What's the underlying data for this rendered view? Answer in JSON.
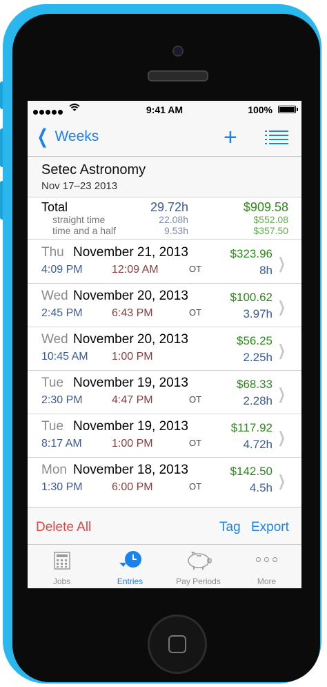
{
  "status_bar": {
    "time": "9:41 AM",
    "battery": "100%",
    "signal_dots": 5
  },
  "nav": {
    "back_label": "Weeks"
  },
  "summary": {
    "job_name": "Setec Astronomy",
    "date_range": "Nov 17–23 2013"
  },
  "totals": {
    "label": "Total",
    "hours": "29.72h",
    "amount": "$909.58",
    "breakdown": [
      {
        "label": "straight time",
        "hours": "22.08h",
        "amount": "$552.08"
      },
      {
        "label": "time and a half",
        "hours": "9.53h",
        "amount": "$357.50"
      }
    ]
  },
  "entries": [
    {
      "dow": "Thu",
      "date": "November 21, 2013",
      "amount": "$323.96",
      "start": "4:09 PM",
      "end": "12:09 AM",
      "ot": "OT",
      "hours": "8h"
    },
    {
      "dow": "Wed",
      "date": "November 20, 2013",
      "amount": "$100.62",
      "start": "2:45 PM",
      "end": "6:43 PM",
      "ot": "OT",
      "hours": "3.97h"
    },
    {
      "dow": "Wed",
      "date": "November 20, 2013",
      "amount": "$56.25",
      "start": "10:45 AM",
      "end": "1:00 PM",
      "ot": "",
      "hours": "2.25h"
    },
    {
      "dow": "Tue",
      "date": "November 19, 2013",
      "amount": "$68.33",
      "start": "2:30 PM",
      "end": "4:47 PM",
      "ot": "OT",
      "hours": "2.28h"
    },
    {
      "dow": "Tue",
      "date": "November 19, 2013",
      "amount": "$117.92",
      "start": "8:17 AM",
      "end": "1:00 PM",
      "ot": "OT",
      "hours": "4.72h"
    },
    {
      "dow": "Mon",
      "date": "November 18, 2013",
      "amount": "$142.50",
      "start": "1:30 PM",
      "end": "6:00 PM",
      "ot": "OT",
      "hours": "4.5h"
    }
  ],
  "toolbar": {
    "delete_all": "Delete All",
    "tag": "Tag",
    "export": "Export"
  },
  "tabs": [
    {
      "label": "Jobs",
      "icon": "calculator-icon",
      "active": false
    },
    {
      "label": "Entries",
      "icon": "clock-icon",
      "active": true
    },
    {
      "label": "Pay Periods",
      "icon": "piggy-bank-icon",
      "active": false
    },
    {
      "label": "More",
      "icon": "more-dots-icon",
      "active": false
    }
  ],
  "colors": {
    "device": "#29b7ee",
    "accent": "#1a82f0",
    "money": "#2d8a1b",
    "hours": "#3a5a97",
    "end_time": "#8c3d3d",
    "destructive": "#e8433a"
  }
}
